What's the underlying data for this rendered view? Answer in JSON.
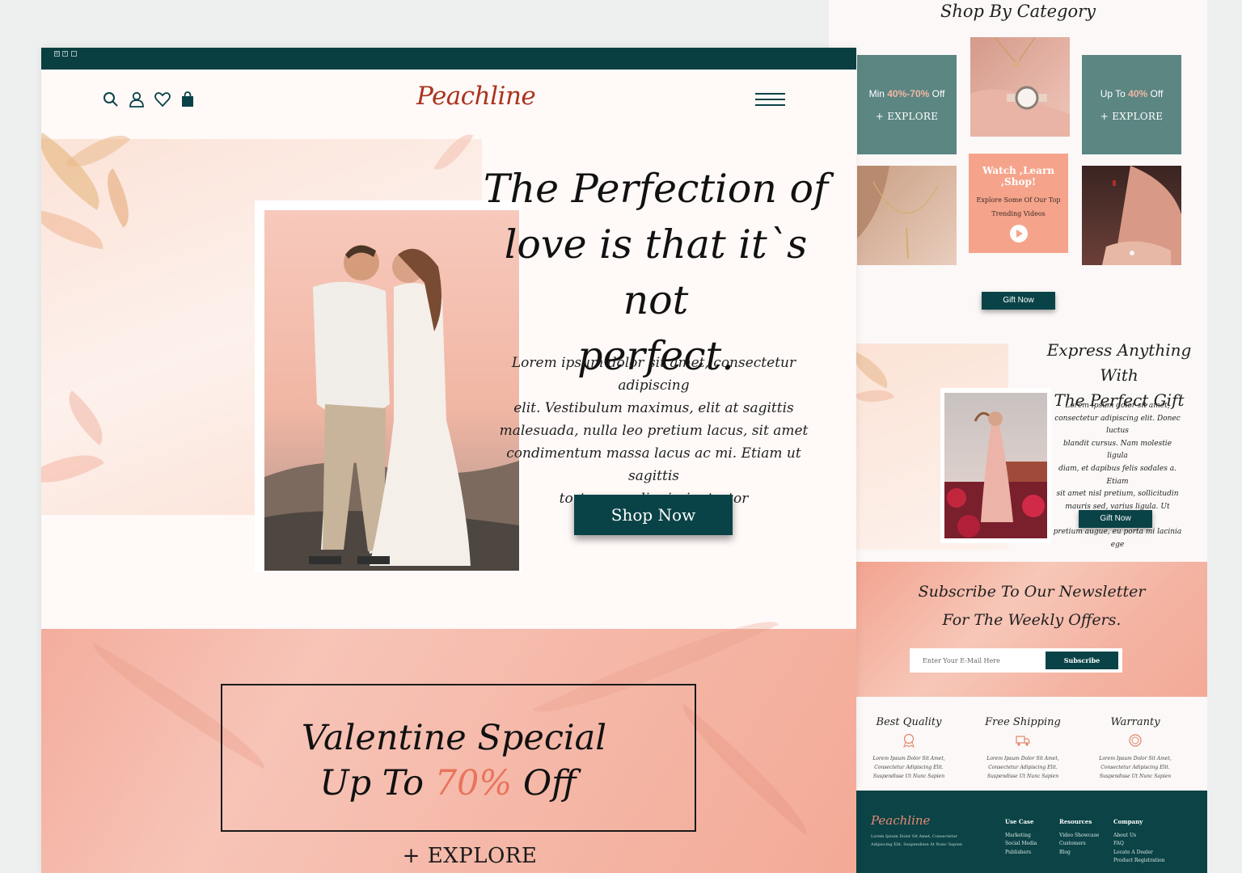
{
  "brand": {
    "name": "Peachline",
    "accent": "#0a4347",
    "logo_color": "#a9341c",
    "peach": "#f5a48b"
  },
  "topbar": {
    "social_icons": [
      "instagram-icon",
      "facebook-icon",
      "twitter-icon"
    ]
  },
  "header": {
    "icons": [
      "search-icon",
      "user-icon",
      "heart-icon",
      "bag-icon",
      "menu-icon"
    ]
  },
  "hero": {
    "title_lines": [
      "The Perfection of",
      "love is that it`s not",
      "perfect."
    ],
    "text_lines": [
      "Lorem ipsum dolor sit amet, consectetur adipiscing",
      "elit. Vestibulum maximus, elit at sagittis",
      "malesuada, nulla leo pretium lacus, sit amet",
      "condimentum massa lacus ac mi. Etiam ut sagittis",
      "tortor, nec dignissim tortor"
    ],
    "button": "Shop Now"
  },
  "promo": {
    "line1": "Valentine Special",
    "line2_prefix": "Up To ",
    "line2_pct": "70%",
    "line2_suffix": " Off",
    "explore": "+ EXPLORE"
  },
  "category": {
    "title": "Shop By Category",
    "tile1": {
      "pre": "Min ",
      "pct": "40%-70%",
      "post": " Off",
      "explore": "+ EXPLORE"
    },
    "tile2": {
      "pre": "Up To ",
      "pct": "40%",
      "post": " Off",
      "explore": "+ EXPLORE"
    },
    "video": {
      "title": "Watch ,Learn ,Shop!",
      "line1": "Explore Some Of Our Top",
      "line2": "Trending Videos"
    },
    "button": "Gift Now"
  },
  "gift": {
    "heading_lines": [
      "Express Anything With",
      "The Perfect Gift"
    ],
    "text_lines": [
      "Lorem ipsum dolor sit amet,",
      "consectetur adipiscing elit. Donec luctus",
      "blandit cursus. Nam molestie ligula",
      "diam, et dapibus felis sodales a. Etiam",
      "sit amet nisl pretium, sollicitudin",
      "mauris sed, varius ligula. Ut tincidunt",
      "pretium augue, eu porta mi lacinia ege"
    ],
    "button": "Gift Now"
  },
  "newsletter": {
    "line1": "Subscribe To Our Newsletter",
    "line2": "For The Weekly Offers.",
    "placeholder": "Enter Your E-Mail Here",
    "button": "Subscribe"
  },
  "features": [
    {
      "title": "Best Quality",
      "text": "Lorem Ipsum Dolor Sit Amet, Consectetur Adipiscing Elit. Suspendisse Ut Nunc Sapien"
    },
    {
      "title": "Free Shipping",
      "text": "Lorem Ipsum Dolor Sit Amet, Consectetur Adipiscing Elit. Suspendisse Ut Nunc Sapien"
    },
    {
      "title": "Warranty",
      "text": "Lorem Ipsum Dolor Sit Amet, Consectetur Adipiscing Elit. Suspendisse Ut Nunc Sapien"
    }
  ],
  "footer": {
    "logo": "Peachline",
    "desc": "Lorem Ipsum Dolor Sit Amet, Consectetur Adipiscing Elit. Suspendisse At Nunc Sapien",
    "use_case": {
      "title": "Use Case",
      "items": [
        "Marketing",
        "Social Media",
        "Publishers"
      ]
    },
    "resources": {
      "title": "Resources",
      "items": [
        "Video Showcase",
        "Customers",
        "Blog"
      ]
    },
    "company": {
      "title": "Company",
      "items": [
        "About Us",
        "FAQ",
        "Locate A Dealer",
        "Product Registration"
      ]
    }
  }
}
